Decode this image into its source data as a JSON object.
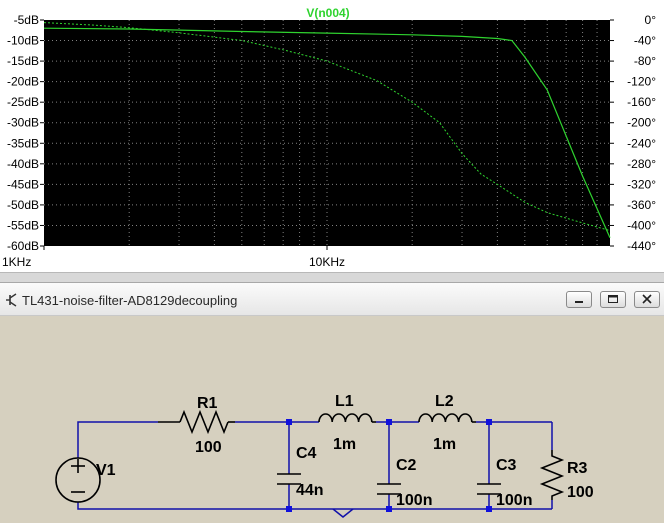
{
  "plot": {
    "trace_name": "V(n004)",
    "left_axis_ticks": [
      "-5dB",
      "-10dB",
      "-15dB",
      "-20dB",
      "-25dB",
      "-30dB",
      "-35dB",
      "-40dB",
      "-45dB",
      "-50dB",
      "-55dB",
      "-60dB"
    ],
    "right_axis_ticks": [
      "0°",
      "-40°",
      "-80°",
      "-120°",
      "-160°",
      "-200°",
      "-240°",
      "-280°",
      "-320°",
      "-360°",
      "-400°",
      "-440°"
    ],
    "x_axis_ticks": [
      "1KHz",
      "10KHz"
    ],
    "colors": {
      "background": "#000000",
      "grid": "#808080",
      "trace": "#2fd32f"
    }
  },
  "chart_data": {
    "type": "line",
    "title": "V(n004)",
    "x_scale": "log",
    "x_unit": "Hz",
    "xlim": [
      1000,
      100000
    ],
    "ylim_left": [
      -60,
      -5
    ],
    "ylim_right": [
      -440,
      0
    ],
    "grid": true,
    "series": [
      {
        "axis": "left",
        "style": "solid",
        "x": [
          1000,
          2000,
          5000,
          10000,
          20000,
          30000,
          40000,
          45000,
          50000,
          60000,
          80000,
          100000
        ],
        "y": [
          -7,
          -7.2,
          -7.8,
          -8.2,
          -8.6,
          -9.0,
          -9.5,
          -10,
          -14,
          -22,
          -43,
          -58
        ]
      },
      {
        "axis": "right",
        "style": "dotted",
        "x": [
          1000,
          1500,
          2000,
          3000,
          5000,
          7000,
          10000,
          15000,
          20000,
          25000,
          30000,
          35000,
          40000,
          50000,
          60000,
          80000,
          100000
        ],
        "y": [
          -5,
          -10,
          -15,
          -25,
          -40,
          -58,
          -80,
          -118,
          -160,
          -200,
          -260,
          -300,
          -320,
          -355,
          -375,
          -395,
          -410
        ]
      }
    ]
  },
  "window": {
    "title": "TL431-noise-filter-AD8129decoupling"
  },
  "schematic": {
    "components": {
      "v1": {
        "name": "V1"
      },
      "r1": {
        "name": "R1",
        "value": "100"
      },
      "l1": {
        "name": "L1",
        "value": "1m"
      },
      "l2": {
        "name": "L2",
        "value": "1m"
      },
      "c4": {
        "name": "C4",
        "value": "44n"
      },
      "c2": {
        "name": "C2",
        "value": "100n"
      },
      "c3": {
        "name": "C3",
        "value": "100n"
      },
      "r3": {
        "name": "R3",
        "value": "100"
      }
    },
    "colors": {
      "wire": "#1111aa",
      "junction": "#1111dd",
      "component": "#000000",
      "background": "#d6d0bf"
    }
  }
}
